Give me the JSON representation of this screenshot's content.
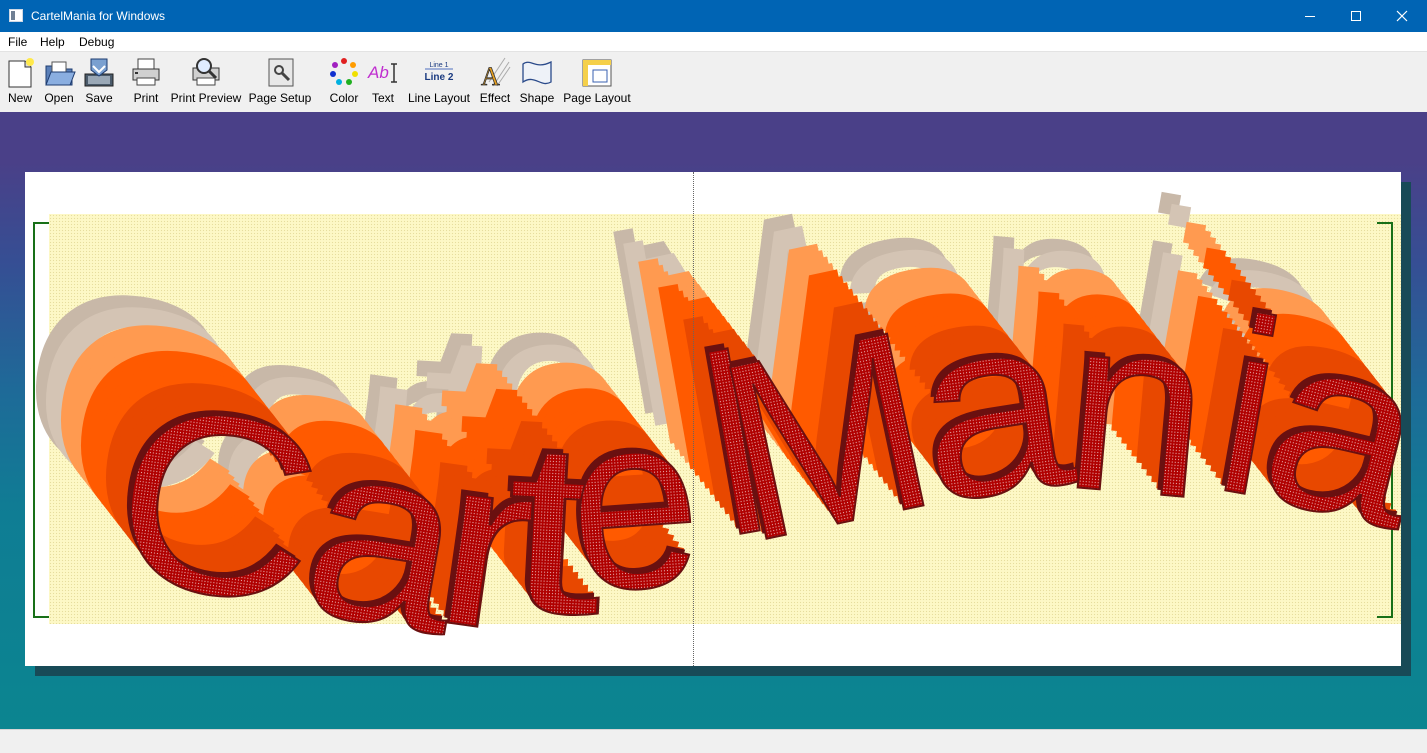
{
  "window": {
    "title": "CartelMania for Windows",
    "controls": {
      "minimize": "minimize",
      "maximize": "maximize",
      "close": "close"
    }
  },
  "menu": [
    "File",
    "Help",
    "Debug"
  ],
  "toolbar": [
    {
      "label": "New",
      "icon": "new-document-icon"
    },
    {
      "label": "Open",
      "icon": "open-folder-icon"
    },
    {
      "label": "Save",
      "icon": "save-icon"
    },
    {
      "label": "Print",
      "icon": "printer-icon"
    },
    {
      "label": "Print Preview",
      "icon": "print-preview-icon"
    },
    {
      "label": "Page Setup",
      "icon": "page-setup-icon"
    },
    {
      "label": "Color",
      "icon": "color-palette-icon"
    },
    {
      "label": "Text",
      "icon": "text-icon",
      "glyph": "Ab"
    },
    {
      "label": "Line Layout",
      "icon": "line-layout-icon",
      "line1": "Line 1",
      "line2": "Line 2"
    },
    {
      "label": "Effect",
      "icon": "effect-icon",
      "glyph": "A"
    },
    {
      "label": "Shape",
      "icon": "shape-icon"
    },
    {
      "label": "Page Layout",
      "icon": "page-layout-icon"
    }
  ],
  "banner": {
    "text": "CartelMania",
    "colors": {
      "face": "#b00000",
      "outline": "#6a1010",
      "extrude": "#ff5a00",
      "shadow": "#c8b8a8",
      "background": "#fdf8c6",
      "bracket": "#187018",
      "workspace_top": "#4a4088",
      "workspace_bottom": "#0b8590"
    }
  },
  "status": ""
}
